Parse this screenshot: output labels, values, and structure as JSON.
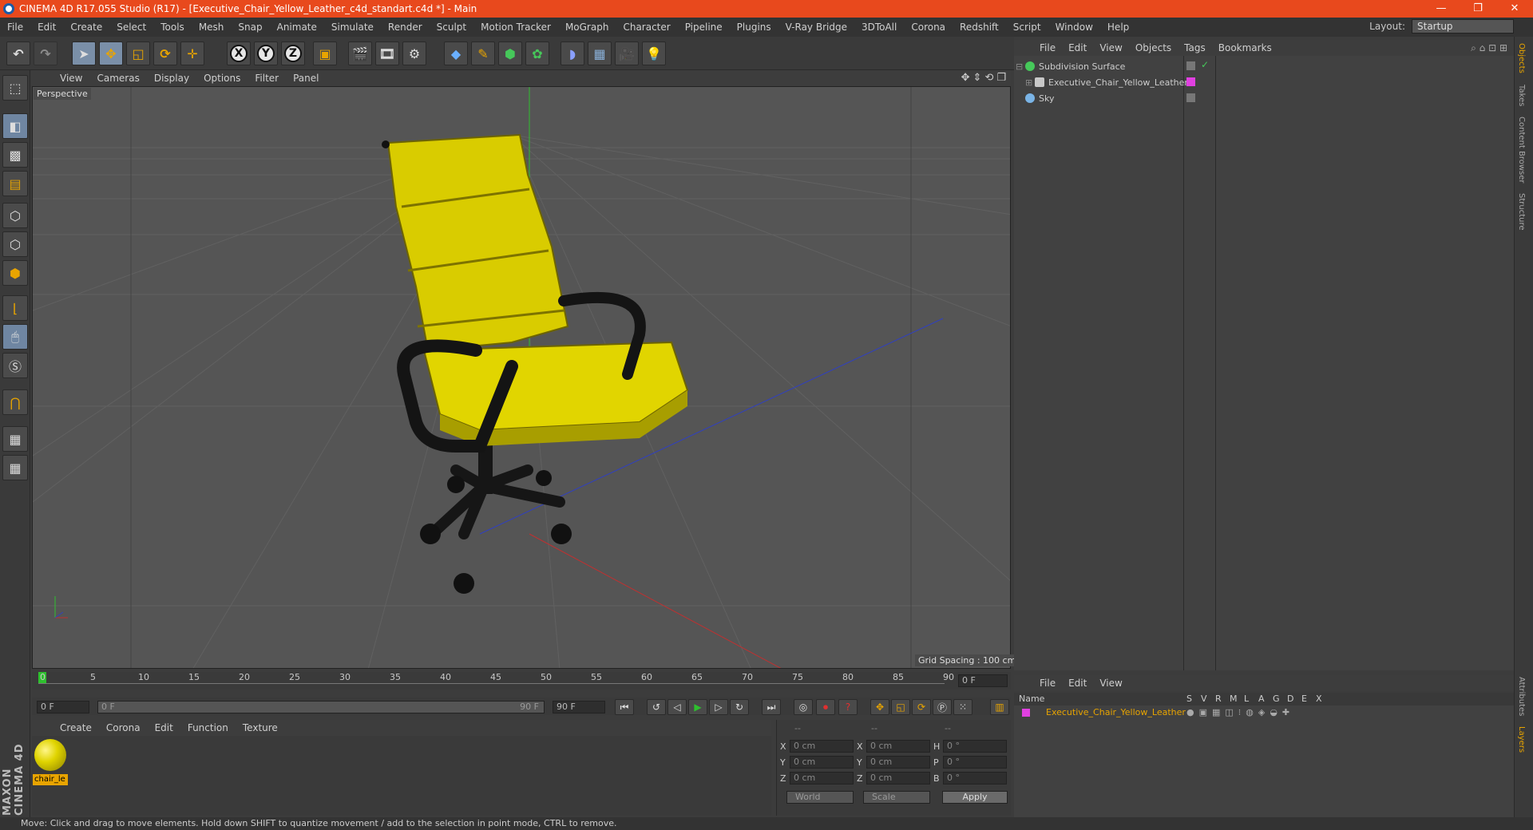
{
  "window": {
    "title": "CINEMA 4D R17.055 Studio (R17) - [Executive_Chair_Yellow_Leather_c4d_standart.c4d *] - Main",
    "min": "—",
    "max": "❐",
    "close": "✕"
  },
  "menu": [
    "File",
    "Edit",
    "Create",
    "Select",
    "Tools",
    "Mesh",
    "Snap",
    "Animate",
    "Simulate",
    "Render",
    "Sculpt",
    "Motion Tracker",
    "MoGraph",
    "Character",
    "Pipeline",
    "Plugins",
    "V-Ray Bridge",
    "3DToAll",
    "Corona",
    "Redshift",
    "Script",
    "Window",
    "Help"
  ],
  "layout": {
    "label": "Layout:",
    "value": "Startup"
  },
  "toolbar": {
    "x": "X",
    "y": "Y",
    "z": "Z"
  },
  "viewport": {
    "menu": [
      "View",
      "Cameras",
      "Display",
      "Options",
      "Filter",
      "Panel"
    ],
    "label": "Perspective",
    "grid_spacing": "Grid Spacing : 100 cm"
  },
  "timeline": {
    "ticks": [
      "0",
      "5",
      "10",
      "15",
      "20",
      "25",
      "30",
      "35",
      "40",
      "45",
      "50",
      "55",
      "60",
      "65",
      "70",
      "75",
      "80",
      "85",
      "90"
    ],
    "end_field": "0 F",
    "start": "0 F",
    "range_start": "0 F",
    "range_end": "90 F",
    "end": "90 F"
  },
  "material": {
    "menu": [
      "Create",
      "Corona",
      "Edit",
      "Function",
      "Texture"
    ],
    "name": "chair_le"
  },
  "coords": {
    "headers": [
      "--",
      "--",
      "--"
    ],
    "rows": [
      {
        "a": "X",
        "av": "0 cm",
        "b": "X",
        "bv": "0 cm",
        "c": "H",
        "cv": "0 °"
      },
      {
        "a": "Y",
        "av": "0 cm",
        "b": "Y",
        "bv": "0 cm",
        "c": "P",
        "cv": "0 °"
      },
      {
        "a": "Z",
        "av": "0 cm",
        "b": "Z",
        "bv": "0 cm",
        "c": "B",
        "cv": "0 °"
      }
    ],
    "mode": "World",
    "scale": "Scale",
    "apply": "Apply"
  },
  "objects": {
    "menu": [
      "File",
      "Edit",
      "View",
      "Objects",
      "Tags",
      "Bookmarks"
    ],
    "items": [
      {
        "name": "Subdivision Surface",
        "color": "#46c85a"
      },
      {
        "name": "Executive_Chair_Yellow_Leather",
        "color": "#c8c8c8"
      },
      {
        "name": "Sky",
        "color": "#7ab4e6"
      }
    ]
  },
  "layers": {
    "menu": [
      "File",
      "Edit",
      "View"
    ],
    "columns": [
      "Name",
      "S",
      "V",
      "R",
      "M",
      "L",
      "A",
      "G",
      "D",
      "E",
      "X"
    ],
    "items": [
      {
        "name": "Executive_Chair_Yellow_Leather"
      }
    ]
  },
  "right_tabs": [
    "Objects",
    "Takes",
    "Content Browser",
    "Structure",
    "Attributes",
    "Layers"
  ],
  "status": "Move: Click and drag to move elements. Hold down SHIFT to quantize movement / add to the selection in point mode, CTRL to remove.",
  "brand": "MAXON CINEMA 4D",
  "colors": {
    "title_bar": "#e8491d",
    "chair": "#e0d400",
    "layer_accent": "#e8a400",
    "layer_swatch": "#e040e0"
  }
}
